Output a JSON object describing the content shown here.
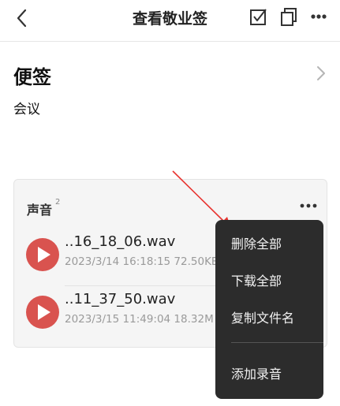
{
  "header": {
    "title": "查看敬业签",
    "icons": [
      "back-icon",
      "checkbox-icon",
      "copy-icon",
      "more-icon"
    ]
  },
  "note": {
    "heading": "便签",
    "body": "会议"
  },
  "sound_card": {
    "title": "声音",
    "count": "2",
    "items": [
      {
        "name": "..16_18_06.wav",
        "meta": "2023/3/14 16:18:15 72.50KB"
      },
      {
        "name": "..11_37_50.wav",
        "meta": "2023/3/15 11:49:04 18.32M"
      }
    ]
  },
  "menu": {
    "items": [
      "删除全部",
      "下载全部",
      "复制文件名",
      "添加录音"
    ]
  },
  "colors": {
    "accent_play": "#d9534f",
    "annotation_arrow": "#e8332f",
    "menu_bg": "#2c2c2c"
  }
}
